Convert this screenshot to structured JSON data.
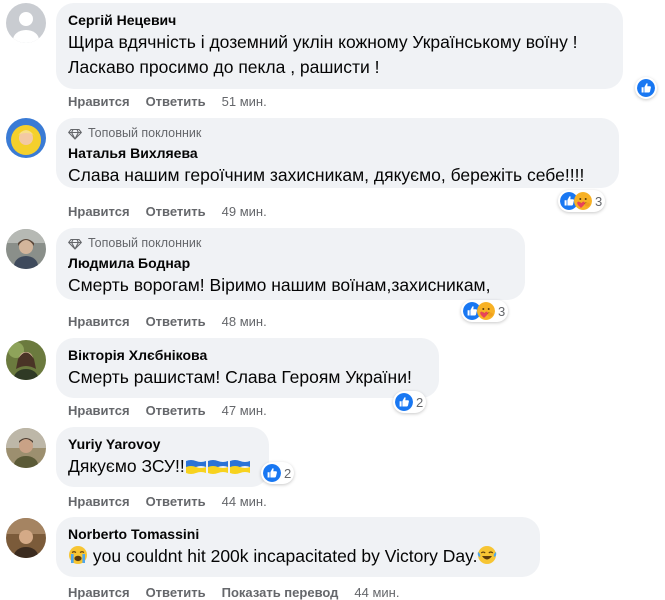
{
  "actions": {
    "like": "Нравится",
    "reply": "Ответить",
    "translate": "Показать перевод"
  },
  "badges": {
    "top_fan": "Топовый поклонник"
  },
  "colors": {
    "like_blue": "#1877f2",
    "bubble_bg": "#f0f2f5",
    "meta_grey": "#65676b"
  },
  "comments": [
    {
      "author": "Сергій Нецевич",
      "lines": [
        "Щира вдячність і доземний уклін кожному Українському воїну !",
        "Ласкаво просимо до пекла , рашисти !"
      ],
      "time": "51 мин.",
      "reactions": {
        "icons": [
          "like-icon"
        ],
        "count": ""
      }
    },
    {
      "author": "Наталья Вихляева",
      "badge": "Топовый поклонник",
      "lines": [
        "Слава нашим героїчним захисникам, дякуємо, бережіть себе!!!!"
      ],
      "time": "49 мин.",
      "reactions": {
        "icons": [
          "like-icon",
          "care-icon"
        ],
        "count": "3"
      }
    },
    {
      "author": "Людмила Боднар",
      "badge": "Топовый поклонник",
      "lines": [
        "Смерть ворогам! Віримо нашим воїнам,захисникам,"
      ],
      "time": "48 мин.",
      "reactions": {
        "icons": [
          "like-icon",
          "care-icon"
        ],
        "count": "3"
      }
    },
    {
      "author": "Вікторія Хлєбнікова",
      "lines": [
        "Смерть рашистам! Слава Героям України!"
      ],
      "time": "47 мин.",
      "reactions": {
        "icons": [
          "like-icon"
        ],
        "count": "2"
      }
    },
    {
      "author": "Yuriy Yarovoy",
      "lines": [
        "Дякуємо ЗСУ!!"
      ],
      "emoji": [
        "ukraine-flag-icon",
        "ukraine-flag-icon",
        "ukraine-flag-icon"
      ],
      "time": "44 мин.",
      "reactions": {
        "icons": [
          "like-icon"
        ],
        "count": "2"
      }
    },
    {
      "author": "Norberto Tomassini",
      "lines": [
        "you couldnt hit 200k incapacitated by Victory Day."
      ],
      "emoji": [
        "crying-face-icon",
        "tears-of-joy-icon"
      ],
      "time": "44 мин."
    }
  ]
}
